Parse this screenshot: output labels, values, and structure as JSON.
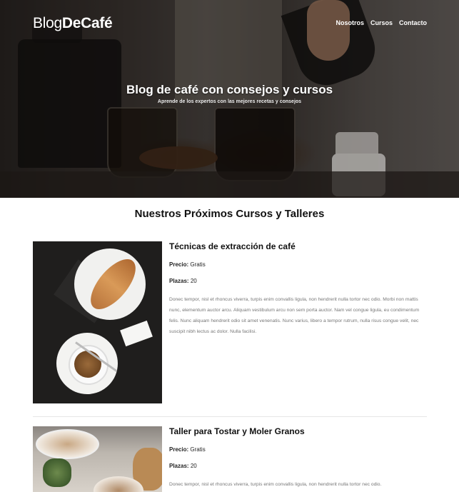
{
  "header": {
    "logo_light": "Blog",
    "logo_bold": "DeCafé",
    "nav": [
      {
        "label": "Nosotros"
      },
      {
        "label": "Cursos"
      },
      {
        "label": "Contacto"
      }
    ]
  },
  "hero": {
    "title": "Blog de café con consejos y cursos",
    "subtitle": "Aprende de los expertos con las mejores recetas y consejos"
  },
  "main": {
    "section_title": "Nuestros Próximos Cursos y Talleres",
    "courses": [
      {
        "title": "Técnicas de extracción de café",
        "price_label": "Precio:",
        "price": "Gratis",
        "seats_label": "Plazas:",
        "seats": "20",
        "description": "Donec tempor, nisl et rhoncus viverra, turpis enim convallis ligula, non hendrerit nulla tortor nec odio. Morbi non mattis nunc, elementum auctor arcu. Aliquam vestibulum arcu non sem porta auctor. Nam vel congue ligula, eu condimentum felis. Nunc aliquam hendrerit odio sit amet venenatis. Nunc varius, libero a tempor rutrum, nulla risus congue velit, nec suscipit nibh lectus ac dolor. Nulla facilisi."
      },
      {
        "title": "Taller para Tostar y Moler Granos",
        "price_label": "Precio:",
        "price": "Gratis",
        "seats_label": "Plazas:",
        "seats": "20",
        "description": "Donec tempor, nisl et rhoncus viverra, turpis enim convallis ligula, non hendrerit nulla tortor nec odio."
      }
    ]
  }
}
